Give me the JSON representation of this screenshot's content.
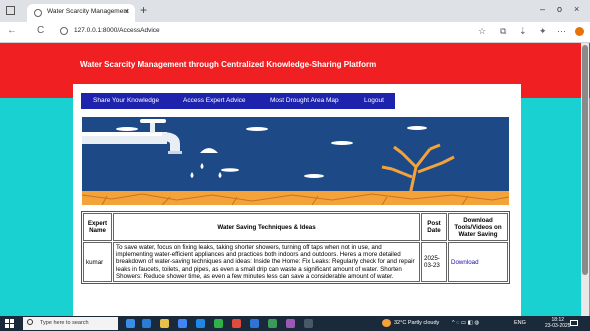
{
  "browser": {
    "tab_title": "Water Scarcity Management",
    "tab_close": "×",
    "new_tab": "+",
    "url": "127.0.0.1:8000/AccessAdvice",
    "back": "←",
    "refresh": "C",
    "minimize": "–",
    "maximize": "o",
    "close": "×",
    "star": "☆",
    "download": "⇣",
    "menu": "⋯"
  },
  "page": {
    "title": "Water Scarcity Management through Centralized Knowledge-Sharing Platform",
    "nav": [
      "Share Your Knowledge",
      "Access Expert Advice",
      "Most Drought Area Map",
      "Logout"
    ]
  },
  "table": {
    "headers": {
      "expert": "Expert Name",
      "techniques": "Water Saving Techniques & Ideas",
      "date": "Post Date",
      "download": "Download Tools/Videos on Water Saving"
    },
    "rows": [
      {
        "expert": "kumar",
        "techniques": "To save water, focus on fixing leaks, taking shorter showers, turning off taps when not in use, and implementing water-efficient appliances and practices both indoors and outdoors. Heres a more detailed breakdown of water-saving techniques and ideas: Inside the Home: Fix Leaks: Regularly check for and repair leaks in faucets, toilets, and pipes, as even a small drip can waste a significant amount of water. Shorten Showers: Reduce shower time, as even a few minutes less can save a considerable amount of water.",
        "date": "2025-03-23",
        "download": "Download"
      }
    ]
  },
  "taskbar": {
    "search_placeholder": "Type here to search",
    "weather": "32°C  Partly cloudy",
    "language": "ENG",
    "time": "18:12",
    "date": "23-03-2025"
  },
  "colors": {
    "header_red": "#f01f22",
    "teal": "#19d1d1",
    "nav_blue": "#1d23ac",
    "banner_blue": "#1d4a86",
    "soil_orange": "#f4a23a"
  }
}
